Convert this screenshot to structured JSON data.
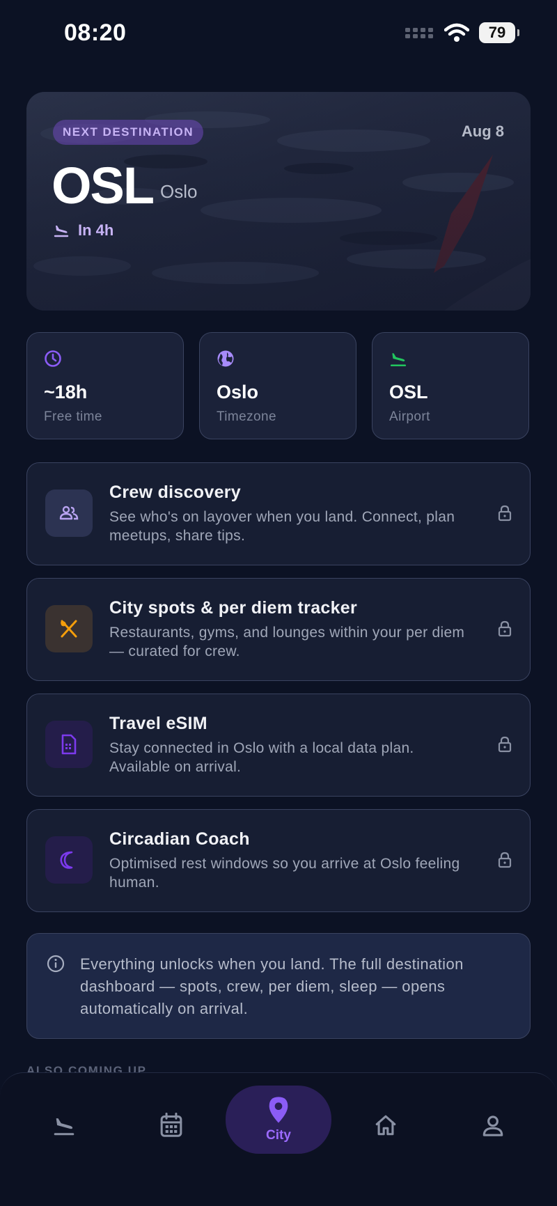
{
  "status_bar": {
    "time": "08:20",
    "battery": "79"
  },
  "hero": {
    "badge": "NEXT DESTINATION",
    "date": "Aug 8",
    "code": "OSL",
    "city": "Oslo",
    "eta": "In 4h"
  },
  "info_cards": [
    {
      "icon": "clock-icon",
      "value": "~18h",
      "label": "Free time"
    },
    {
      "icon": "globe-icon",
      "value": "Oslo",
      "label": "Timezone"
    },
    {
      "icon": "plane-landing-icon",
      "value": "OSL",
      "label": "Airport"
    }
  ],
  "features": [
    {
      "icon": "people-icon",
      "title": "Crew discovery",
      "desc": "See who's on layover when you land. Connect, plan meetups, share tips.",
      "locked": true
    },
    {
      "icon": "fork-knife-icon",
      "title": "City spots & per diem tracker",
      "desc": "Restaurants, gyms, and lounges within your per diem — curated for crew.",
      "locked": true
    },
    {
      "icon": "sim-card-icon",
      "title": "Travel eSIM",
      "desc": "Stay connected in Oslo with a local data plan. Available on arrival.",
      "locked": true
    },
    {
      "icon": "moon-icon",
      "title": "Circadian Coach",
      "desc": "Optimised rest windows so you arrive at Oslo feeling human.",
      "locked": true
    }
  ],
  "notice": {
    "text": "Everything unlocks when you land. The full destination dashboard — spots, crew, per diem, sleep — opens automatically on arrival."
  },
  "also_heading": "ALSO COMING UP",
  "tabs": [
    {
      "icon": "plane-landing-icon",
      "label": ""
    },
    {
      "icon": "calendar-icon",
      "label": ""
    },
    {
      "icon": "map-pin-icon",
      "label": "City",
      "active": true
    },
    {
      "icon": "home-icon",
      "label": ""
    },
    {
      "icon": "profile-icon",
      "label": ""
    }
  ],
  "colors": {
    "accent": "#8b5cf6",
    "background": "#0c1224",
    "success": "#22c55e",
    "warning": "#f59e0b"
  }
}
